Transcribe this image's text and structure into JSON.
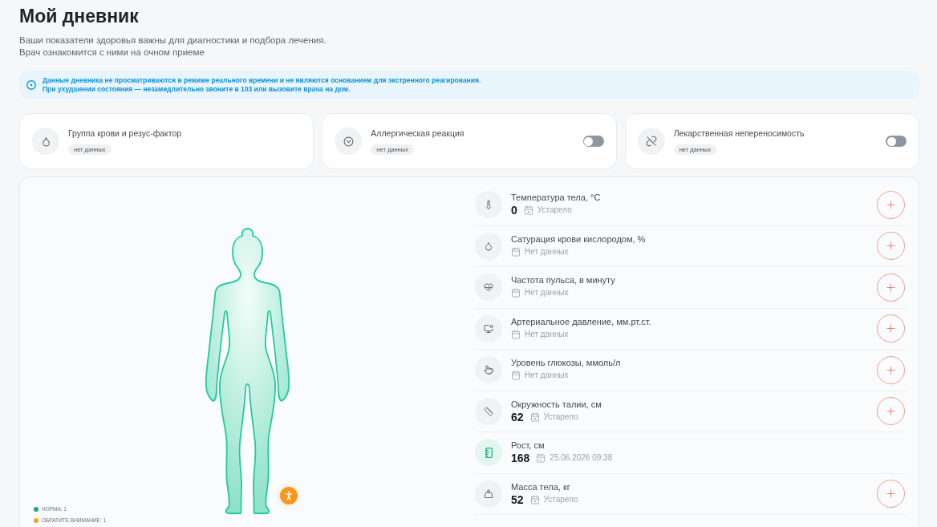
{
  "page": {
    "title": "Мой дневник",
    "subtitle_lines": [
      "Ваши показатели здоровья важны для диагностики и подбора лечения.",
      "Врач ознакомится с ними на очном приеме"
    ]
  },
  "notice": {
    "lines": [
      "Данные дневника не просматриваются в режиме реального времени и не являются основанием для экстренного реагирования.",
      "При ухудшении состояния — незамедлительно звоните в 103 или вызовите врача на дом."
    ]
  },
  "cards": [
    {
      "kind": "blood",
      "title": "Группа крови и резус-фактор",
      "badge": "нет данных"
    },
    {
      "kind": "allergy",
      "title": "Аллергическая реакция",
      "badge": "нет данных",
      "on": false
    },
    {
      "kind": "drug",
      "title": "Лекарственная непереносимость",
      "badge": "нет данных",
      "on": false
    }
  ],
  "metrics": [
    {
      "kind": "temperature",
      "title": "Температура тела, °С",
      "value": "0",
      "status": {
        "kind": "outdated",
        "text": "Устарело"
      },
      "normal": false,
      "add_button": true
    },
    {
      "kind": "saturation",
      "title": "Сатурация крови кислородом, %",
      "status": {
        "kind": "none",
        "text": "Нет данных"
      },
      "normal": false,
      "add_button": true
    },
    {
      "kind": "pulse",
      "title": "Частота пульса, в минуту",
      "status": {
        "kind": "none",
        "text": "Нет данных"
      },
      "normal": false,
      "add_button": true
    },
    {
      "kind": "pressure",
      "title": "Артериальное давление, мм.рт.ст.",
      "status": {
        "kind": "none",
        "text": "Нет данных"
      },
      "normal": false,
      "add_button": true
    },
    {
      "kind": "glucose",
      "title": "Уровень глюкозы, ммоль/л",
      "status": {
        "kind": "none",
        "text": "Нет данных"
      },
      "normal": false,
      "add_button": true
    },
    {
      "kind": "waist",
      "title": "Окружность талии, см",
      "value": "62",
      "status": {
        "kind": "outdated",
        "text": "Устарело"
      },
      "normal": false,
      "add_button": true
    },
    {
      "kind": "height",
      "title": "Рост, см",
      "value": "168",
      "status": {
        "kind": "date",
        "text": "25.06.2026 09:38"
      },
      "normal": true,
      "add_button": false
    },
    {
      "kind": "weight",
      "title": "Масса тела, кг",
      "value": "52",
      "status": {
        "kind": "outdated",
        "text": "Устарело"
      },
      "normal": false,
      "add_button": true
    }
  ],
  "legend": [
    {
      "label": "НОРМА: 1",
      "color": "#1aab7b"
    },
    {
      "label": "ОБРАТИТЕ ВНИМАНИЕ: 1",
      "color": "#f7a21b"
    }
  ]
}
